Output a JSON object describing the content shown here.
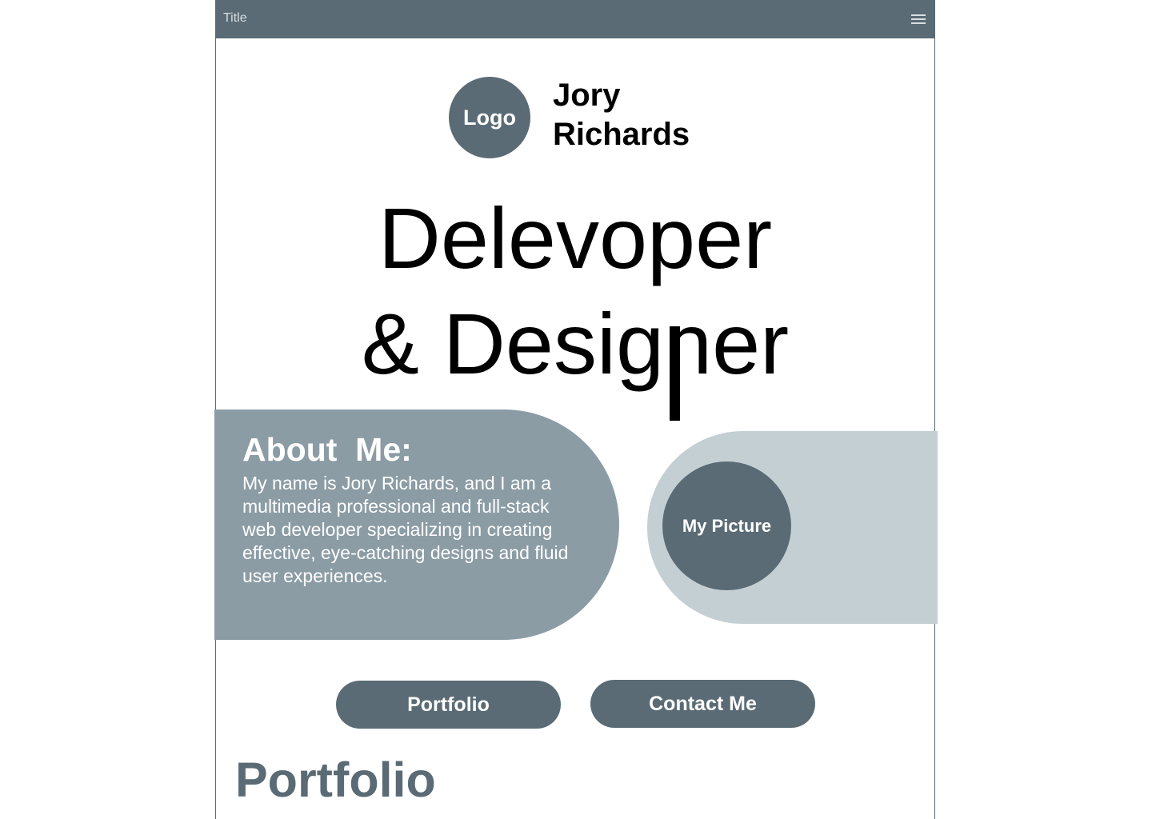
{
  "appbar": {
    "title": "Title",
    "menu_icon": "hamburger-menu-icon"
  },
  "header": {
    "logo_label": "Logo",
    "name_first": "Jory",
    "name_last": "Richards"
  },
  "hero": {
    "line1": "Delevoper",
    "line2": "& Designer"
  },
  "about": {
    "title": "About  Me:",
    "text": "My name is Jory Richards, and I am a multimedia professional and full-stack web developer specializing in creating effective, eye-catching designs and fluid user experiences."
  },
  "picture": {
    "label": "My Picture"
  },
  "buttons": {
    "portfolio": "Portfolio",
    "contact": "Contact Me"
  },
  "portfolio_section": {
    "title": "Portfolio"
  },
  "colors": {
    "primary": "#5a6b75",
    "about_bg": "#8b9ca5",
    "picture_bg": "#c4cfd4",
    "white": "#ffffff"
  }
}
